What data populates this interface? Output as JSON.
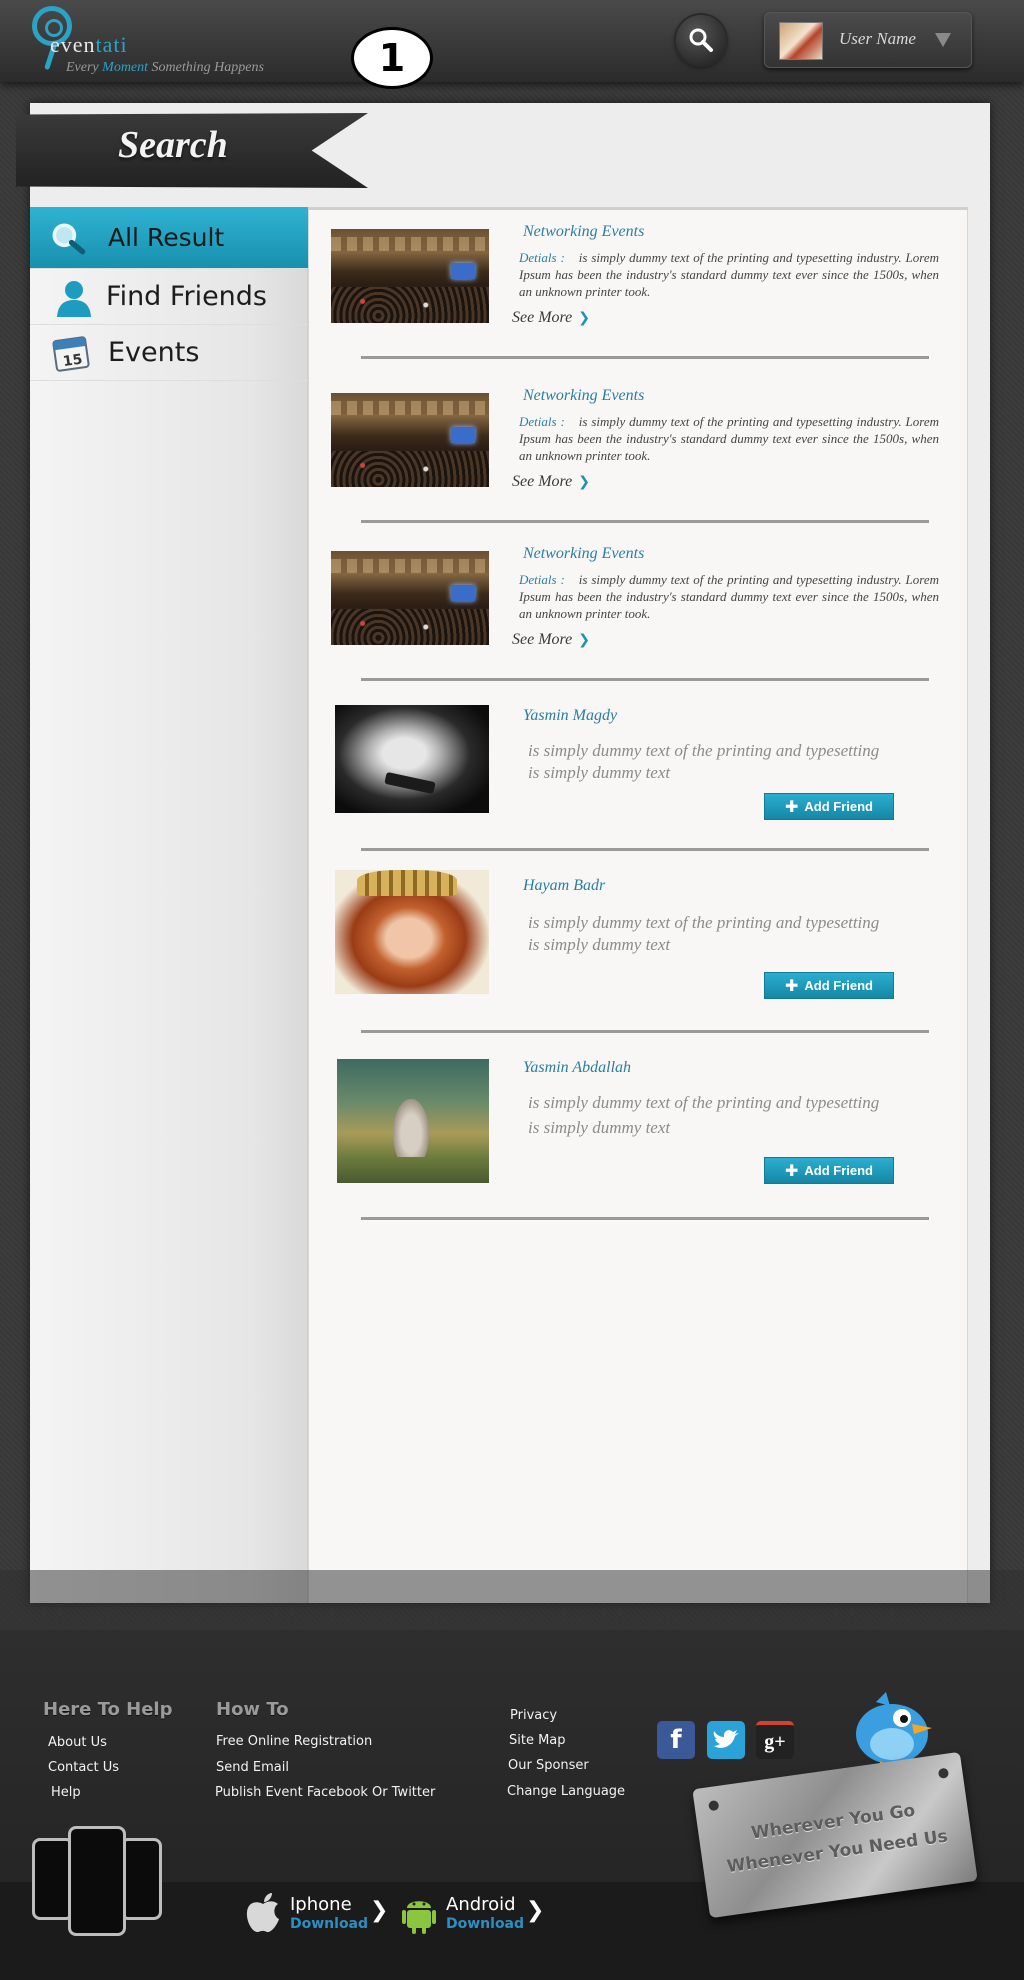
{
  "header": {
    "logo": {
      "name_part1": "even",
      "name_part2": "tati",
      "tagline_part1": "Every ",
      "tagline_highlight": "Moment",
      "tagline_part2": " Something Happens"
    },
    "step_marker": "1",
    "user": {
      "name": "User Name"
    }
  },
  "page": {
    "title": "Search"
  },
  "sidebar": {
    "items": [
      {
        "label": "All Result",
        "icon": "magnifier-icon",
        "active": true
      },
      {
        "label": "Find Friends",
        "icon": "person-icon",
        "active": false
      },
      {
        "label": "Events",
        "icon": "calendar-icon",
        "calendar_day": "15",
        "active": false
      }
    ]
  },
  "results": {
    "events": [
      {
        "title": "Networking Events",
        "details_label": "Detials :",
        "description": "is simply dummy text of the printing and typesetting industry. Lorem Ipsum has been the industry's standard dummy text ever since the 1500s, when an unknown printer took.",
        "see_more": "See More"
      },
      {
        "title": "Networking Events",
        "details_label": "Detials :",
        "description": "is simply dummy text of the printing and typesetting industry. Lorem Ipsum has been the industry's standard dummy text ever since the 1500s, when an unknown printer took.",
        "see_more": "See More"
      },
      {
        "title": "Networking Events",
        "details_label": "Detials :",
        "description": "is simply dummy text of the printing and typesetting industry. Lorem Ipsum has been the industry's standard dummy text ever since the 1500s, when an unknown printer took.",
        "see_more": "See More"
      }
    ],
    "friends": [
      {
        "name": "Yasmin Magdy",
        "line1": "is simply dummy text of the printing and typesetting",
        "line2": "is simply dummy text",
        "button": "Add Friend"
      },
      {
        "name": "Hayam Badr",
        "line1": "is simply dummy text of the printing and typesetting",
        "line2": "is simply dummy text",
        "button": "Add Friend"
      },
      {
        "name": "Yasmin Abdallah",
        "line1": "is simply dummy text of the printing and typesetting",
        "line2": "is simply dummy text",
        "button": "Add Friend"
      }
    ]
  },
  "footer": {
    "here_to_help": {
      "title": "Here To Help",
      "links": [
        "About Us",
        "Contact Us",
        "Help"
      ]
    },
    "how_to": {
      "title": "How To",
      "links": [
        "Free Online Registration",
        "Send Email",
        "Publish Event Facebook Or Twitter"
      ]
    },
    "misc_links": [
      "Privacy",
      "Site Map",
      "Our Sponser",
      "Change Language"
    ],
    "social": [
      {
        "name": "facebook-icon",
        "glyph": "f",
        "color": "#3b5998"
      },
      {
        "name": "twitter-icon",
        "glyph": "t",
        "color": "#2ba3d8"
      },
      {
        "name": "google-plus-icon",
        "glyph": "g+",
        "color": "#222222"
      }
    ],
    "plaque": {
      "line1": "Wherever You Go",
      "line2": "Whenever You Need Us"
    },
    "apps": [
      {
        "name": "Iphone",
        "action": "Download"
      },
      {
        "name": "Android",
        "action": "Download"
      }
    ]
  },
  "colors": {
    "accent": "#2aa3c4",
    "button": "#1b9bbd",
    "panel": "#eeeded",
    "footer": "#2a2a2a"
  }
}
